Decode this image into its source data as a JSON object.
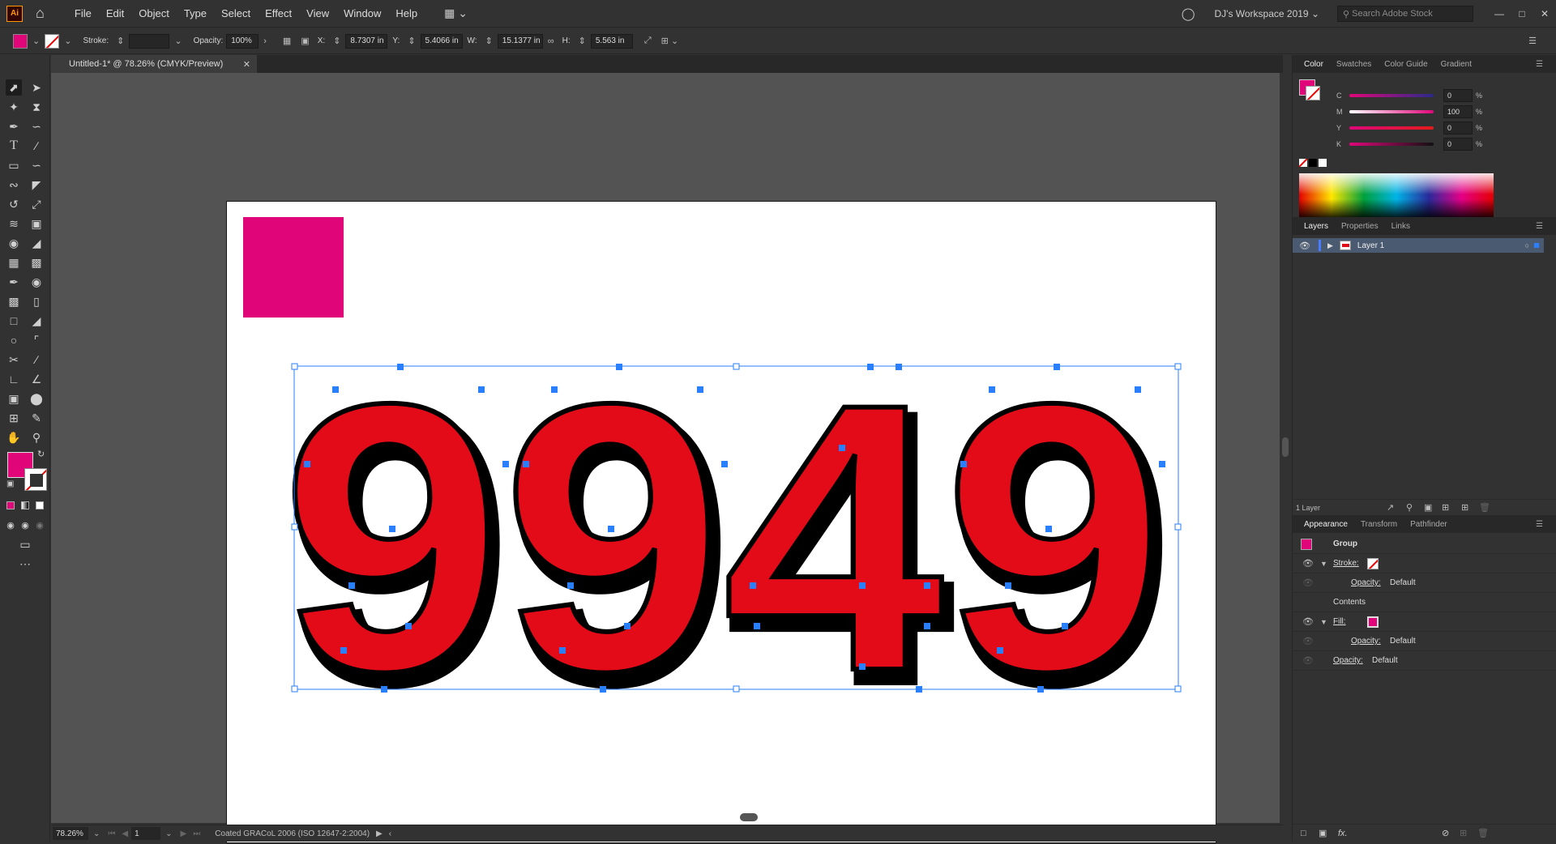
{
  "app": {
    "logo": "Ai"
  },
  "menus": [
    "File",
    "Edit",
    "Object",
    "Type",
    "Select",
    "Effect",
    "View",
    "Window",
    "Help"
  ],
  "workspace": "DJ's Workspace 2019",
  "search_placeholder": "Search Adobe Stock",
  "colors": {
    "fill": "#e0067a",
    "digits_red": "#e30b17",
    "anchor_blue": "#2a7fff"
  },
  "control": {
    "stroke_label": "Stroke:",
    "opacity_label": "Opacity:",
    "opacity_value": "100%",
    "x_label": "X:",
    "x_value": "8.7307 in",
    "y_label": "Y:",
    "y_value": "5.4066 in",
    "w_label": "W:",
    "w_value": "15.1377 in",
    "h_label": "H:",
    "h_value": "5.563 in"
  },
  "document": {
    "tab_title": "Untitled-1* @ 78.26% (CMYK/Preview)",
    "artwork_text": "9949"
  },
  "status": {
    "zoom": "78.26%",
    "artboard": "1",
    "profile": "Coated GRACoL 2006 (ISO 12647-2:2004)"
  },
  "color_panel": {
    "tabs": [
      "Color",
      "Swatches",
      "Color Guide",
      "Gradient"
    ],
    "channels": [
      {
        "label": "C",
        "value": "0",
        "pct": "%"
      },
      {
        "label": "M",
        "value": "100",
        "pct": "%"
      },
      {
        "label": "Y",
        "value": "0",
        "pct": "%"
      },
      {
        "label": "K",
        "value": "0",
        "pct": "%"
      }
    ]
  },
  "layers_panel": {
    "tabs": [
      "Layers",
      "Properties",
      "Links"
    ],
    "layer_name": "Layer 1",
    "count": "1 Layer"
  },
  "appearance_panel": {
    "tabs": [
      "Appearance",
      "Transform",
      "Pathfinder"
    ],
    "group": "Group",
    "stroke": "Stroke:",
    "opacity": "Opacity:",
    "default": "Default",
    "contents": "Contents",
    "fill": "Fill:",
    "fx": "fx."
  }
}
